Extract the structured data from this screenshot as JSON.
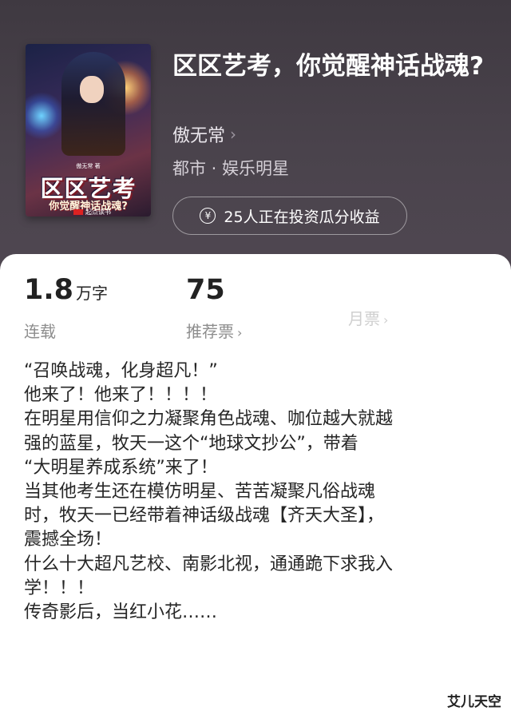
{
  "book": {
    "title": "区区艺考，你觉醒神话战魂?",
    "author": "傲无常",
    "tags": "都市 · 娱乐明星",
    "invest_text": "25人正在投资瓜分收益"
  },
  "cover": {
    "title": "区区艺考",
    "subtitle": "你觉醒神话战魂?",
    "author_small": "傲无常 著",
    "publisher": "起点读书"
  },
  "stats": {
    "words_value": "1.8",
    "words_unit": "万字",
    "status_label": "连载",
    "recommend_value": "75",
    "recommend_label": "推荐票",
    "monthly_label": "月票"
  },
  "description": [
    "“召唤战魂，化身超凡！”",
    "他来了！他来了！！！！",
    "在明星用信仰之力凝聚角色战魂、咖位越大就越",
    "强的蓝星，牧天一这个“地球文抄公”，带着",
    "“大明星养成系统”来了！",
    "当其他考生还在模仿明星、苦苦凝聚凡俗战魂",
    "时，牧天一已经带着神话级战魂【齐天大圣】，",
    "震撼全场！",
    "什么十大超凡艺校、南影北视，通通跪下求我入",
    "学！！！",
    "传奇影后，当红小花……"
  ],
  "watermark": "艾儿天空"
}
